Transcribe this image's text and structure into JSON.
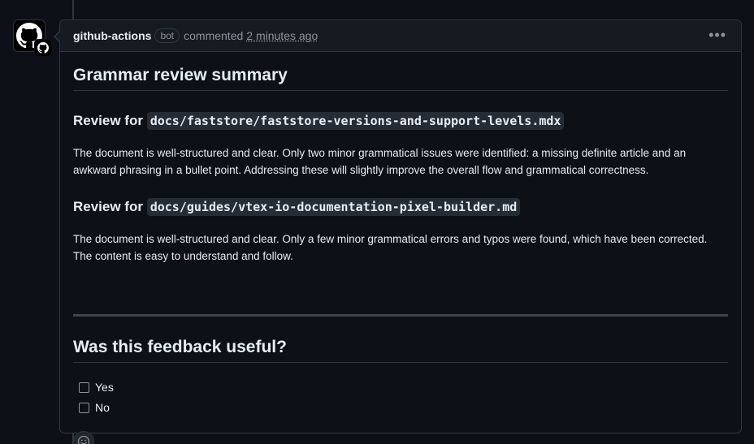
{
  "comment": {
    "author": "github-actions",
    "badge": "bot",
    "action": "commented",
    "timestamp": "2 minutes ago",
    "menu_icon": "kebab-horizontal-icon"
  },
  "body": {
    "title": "Grammar review summary",
    "reviews": [
      {
        "prefix": "Review for",
        "file": "docs/faststore/faststore-versions-and-support-levels.mdx",
        "text": "The document is well-structured and clear. Only two minor grammatical issues were identified: a missing definite article and an awkward phrasing in a bullet point. Addressing these will slightly improve the overall flow and grammatical correctness."
      },
      {
        "prefix": "Review for",
        "file": "docs/guides/vtex-io-documentation-pixel-builder.md",
        "text": "The document is well-structured and clear. Only a few minor grammatical errors and typos were found, which have been corrected. The content is easy to understand and follow."
      }
    ],
    "feedback_title": "Was this feedback useful?",
    "options": [
      {
        "label": "Yes",
        "checked": false
      },
      {
        "label": "No",
        "checked": false
      }
    ]
  },
  "colors": {
    "background": "#0d1117",
    "header": "#161b22",
    "border": "#30363d",
    "text": "#e6edf3",
    "muted": "#8b949e"
  }
}
